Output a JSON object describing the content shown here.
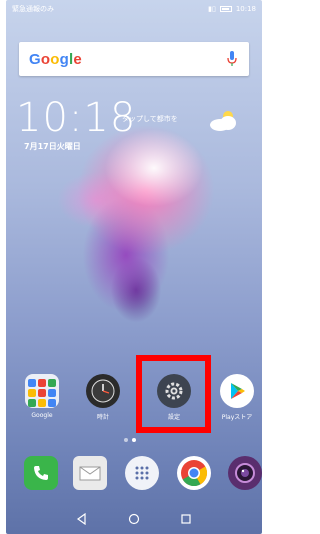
{
  "status_bar": {
    "carrier_text": "緊急通報のみ",
    "time": "10:18"
  },
  "search": {
    "logo_text": "Google",
    "logo_colors": [
      "#4285F4",
      "#EA4335",
      "#FBBC05",
      "#4285F4",
      "#34A853",
      "#EA4335"
    ]
  },
  "lockscreen": {
    "clock": "10:18",
    "weather_tap": "タップして都市を",
    "date": "7月17日火曜日"
  },
  "apps": [
    {
      "label": "Google",
      "icon": "google-folder-icon"
    },
    {
      "label": "時計",
      "icon": "clock-icon"
    },
    {
      "label": "設定",
      "icon": "gear-icon"
    },
    {
      "label": "Playストア",
      "icon": "play-store-icon"
    }
  ],
  "dock": [
    {
      "icon": "phone-icon",
      "color": "#3ab54a"
    },
    {
      "icon": "messages-icon",
      "color": "#e8e8e8"
    },
    {
      "icon": "app-drawer-icon",
      "color": "#ffffff"
    },
    {
      "icon": "chrome-icon",
      "color": "#ffffff"
    },
    {
      "icon": "camera-icon",
      "color": "#5a2e6e"
    }
  ],
  "highlight_color": "#ff0000",
  "page_dots": {
    "count": 2,
    "active": 1
  }
}
